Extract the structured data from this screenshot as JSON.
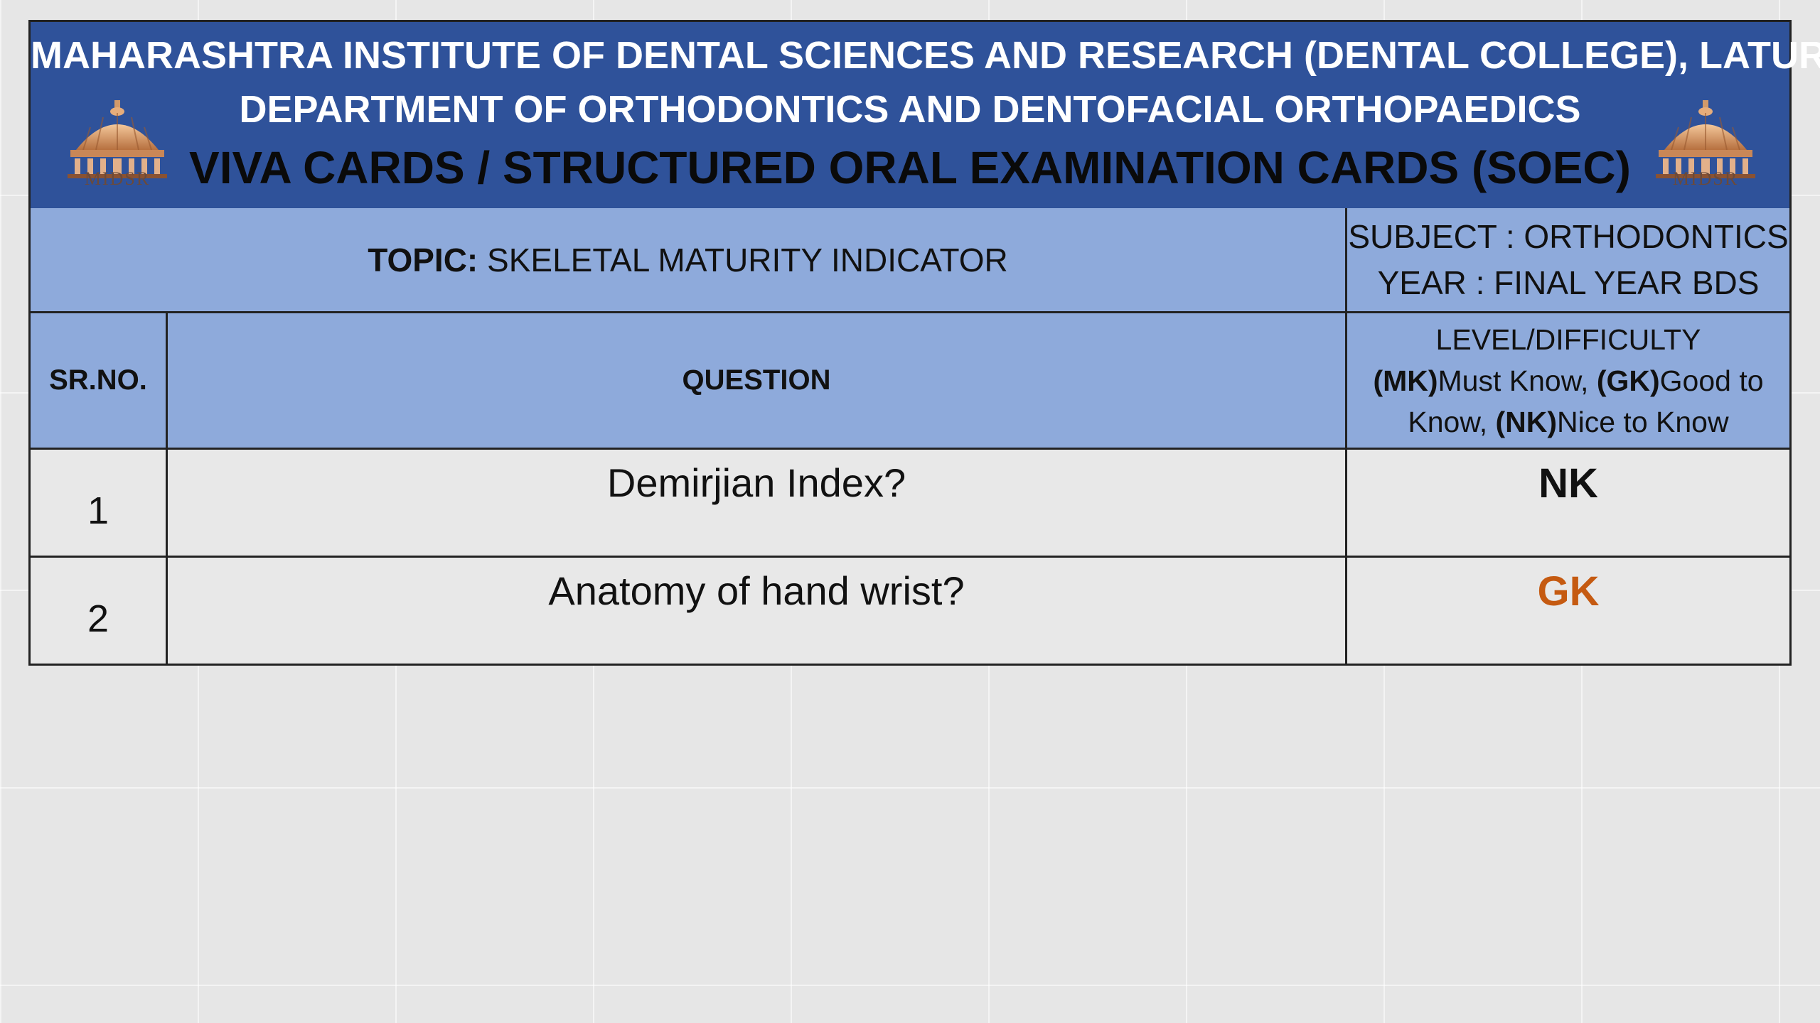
{
  "header": {
    "institute": "MAHARASHTRA INSTITUTE OF DENTAL SCIENCES AND RESEARCH (DENTAL COLLEGE), LATUR",
    "department": "DEPARTMENT OF ORTHODONTICS AND DENTOFACIAL ORTHOPAEDICS",
    "title": "VIVA CARDS / STRUCTURED ORAL EXAMINATION CARDS (SOEC)",
    "logo_text": "MIDSR",
    "logo_icon": "dome-building-logo"
  },
  "topic": {
    "label": "TOPIC:",
    "value": " SKELETAL MATURITY INDICATOR"
  },
  "meta": {
    "subject": "SUBJECT : ORTHODONTICS",
    "year": "YEAR : FINAL YEAR BDS"
  },
  "columns": {
    "sr_no": "SR.NO.",
    "question": "QUESTION",
    "level_title": "LEVEL/DIFFICULTY",
    "mk_code": "(MK)",
    "mk_label": "Must Know, ",
    "gk_code": "(GK)",
    "gk_label": "Good to",
    "know_prefix": "Know, ",
    "nk_code": "(NK)",
    "nk_label": "Nice to Know"
  },
  "rows": [
    {
      "sr": "1",
      "question": "Demirjian Index?",
      "level": "NK",
      "level_color": "#111111"
    },
    {
      "sr": "2",
      "question": "Anatomy of hand wrist?",
      "level": "GK",
      "level_color": "#c55a11"
    }
  ],
  "colors": {
    "header_bg": "#2f529a",
    "table_head_bg": "#8eaadb",
    "body_bg": "#e8e8e8"
  }
}
